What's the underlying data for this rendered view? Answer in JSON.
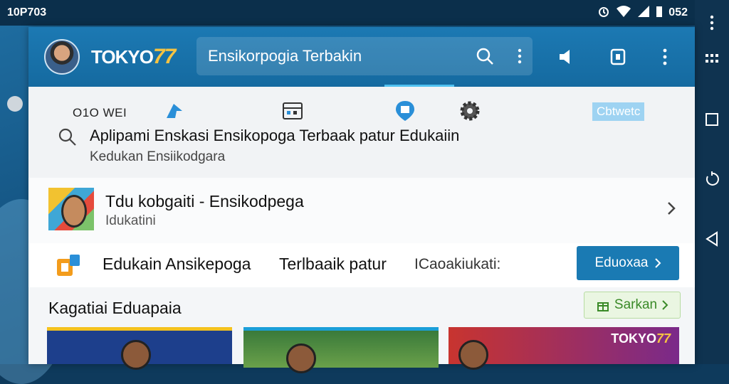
{
  "status_bar": {
    "carrier": "10P703",
    "time": "052"
  },
  "app": {
    "logo_text": "TOKYO",
    "logo_number": "77",
    "search": {
      "placeholder": "Ensikorpogia Terbakin"
    }
  },
  "dropdown": {
    "quick_label": "O1O WEI",
    "chip": "Cbtwetc",
    "suggestion": {
      "main": "Aplipami Enskasi Ensikopoga Terbaak patur Edukaiin",
      "sub": "Kedukan Ensiikodgara"
    }
  },
  "result": {
    "title": "Tdu kobgaiti - Ensikodpega",
    "subtitle": "Idukatini"
  },
  "promo": {
    "text": "Edukain Ansikepoga",
    "text2": "Terlbaaik patur",
    "text3": "ICaoakiukati:",
    "button": "Eduoxaa"
  },
  "category": {
    "title": "Kagatiai Eduapaia",
    "see_all": "Sarkan",
    "tile3_logo": "TOKYO",
    "tile3_number": "77"
  },
  "colors": {
    "primary": "#1a7ab3",
    "accent": "#f6c342",
    "green": "#3a8a28"
  }
}
